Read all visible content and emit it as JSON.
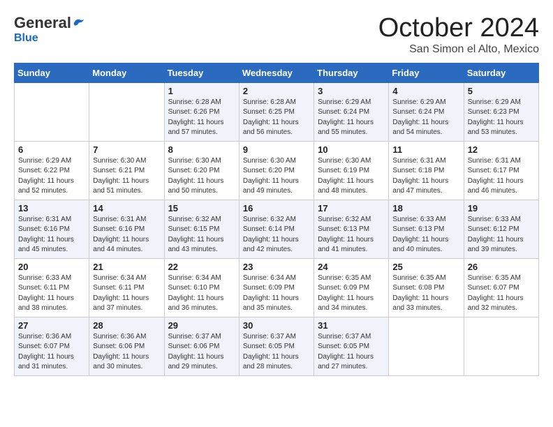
{
  "header": {
    "logo_general": "General",
    "logo_blue": "Blue",
    "month_title": "October 2024",
    "location": "San Simon el Alto, Mexico"
  },
  "weekdays": [
    "Sunday",
    "Monday",
    "Tuesday",
    "Wednesday",
    "Thursday",
    "Friday",
    "Saturday"
  ],
  "weeks": [
    [
      {
        "day": "",
        "sunrise": "",
        "sunset": "",
        "daylight": ""
      },
      {
        "day": "",
        "sunrise": "",
        "sunset": "",
        "daylight": ""
      },
      {
        "day": "1",
        "sunrise": "Sunrise: 6:28 AM",
        "sunset": "Sunset: 6:26 PM",
        "daylight": "Daylight: 11 hours and 57 minutes."
      },
      {
        "day": "2",
        "sunrise": "Sunrise: 6:28 AM",
        "sunset": "Sunset: 6:25 PM",
        "daylight": "Daylight: 11 hours and 56 minutes."
      },
      {
        "day": "3",
        "sunrise": "Sunrise: 6:29 AM",
        "sunset": "Sunset: 6:24 PM",
        "daylight": "Daylight: 11 hours and 55 minutes."
      },
      {
        "day": "4",
        "sunrise": "Sunrise: 6:29 AM",
        "sunset": "Sunset: 6:24 PM",
        "daylight": "Daylight: 11 hours and 54 minutes."
      },
      {
        "day": "5",
        "sunrise": "Sunrise: 6:29 AM",
        "sunset": "Sunset: 6:23 PM",
        "daylight": "Daylight: 11 hours and 53 minutes."
      }
    ],
    [
      {
        "day": "6",
        "sunrise": "Sunrise: 6:29 AM",
        "sunset": "Sunset: 6:22 PM",
        "daylight": "Daylight: 11 hours and 52 minutes."
      },
      {
        "day": "7",
        "sunrise": "Sunrise: 6:30 AM",
        "sunset": "Sunset: 6:21 PM",
        "daylight": "Daylight: 11 hours and 51 minutes."
      },
      {
        "day": "8",
        "sunrise": "Sunrise: 6:30 AM",
        "sunset": "Sunset: 6:20 PM",
        "daylight": "Daylight: 11 hours and 50 minutes."
      },
      {
        "day": "9",
        "sunrise": "Sunrise: 6:30 AM",
        "sunset": "Sunset: 6:20 PM",
        "daylight": "Daylight: 11 hours and 49 minutes."
      },
      {
        "day": "10",
        "sunrise": "Sunrise: 6:30 AM",
        "sunset": "Sunset: 6:19 PM",
        "daylight": "Daylight: 11 hours and 48 minutes."
      },
      {
        "day": "11",
        "sunrise": "Sunrise: 6:31 AM",
        "sunset": "Sunset: 6:18 PM",
        "daylight": "Daylight: 11 hours and 47 minutes."
      },
      {
        "day": "12",
        "sunrise": "Sunrise: 6:31 AM",
        "sunset": "Sunset: 6:17 PM",
        "daylight": "Daylight: 11 hours and 46 minutes."
      }
    ],
    [
      {
        "day": "13",
        "sunrise": "Sunrise: 6:31 AM",
        "sunset": "Sunset: 6:16 PM",
        "daylight": "Daylight: 11 hours and 45 minutes."
      },
      {
        "day": "14",
        "sunrise": "Sunrise: 6:31 AM",
        "sunset": "Sunset: 6:16 PM",
        "daylight": "Daylight: 11 hours and 44 minutes."
      },
      {
        "day": "15",
        "sunrise": "Sunrise: 6:32 AM",
        "sunset": "Sunset: 6:15 PM",
        "daylight": "Daylight: 11 hours and 43 minutes."
      },
      {
        "day": "16",
        "sunrise": "Sunrise: 6:32 AM",
        "sunset": "Sunset: 6:14 PM",
        "daylight": "Daylight: 11 hours and 42 minutes."
      },
      {
        "day": "17",
        "sunrise": "Sunrise: 6:32 AM",
        "sunset": "Sunset: 6:13 PM",
        "daylight": "Daylight: 11 hours and 41 minutes."
      },
      {
        "day": "18",
        "sunrise": "Sunrise: 6:33 AM",
        "sunset": "Sunset: 6:13 PM",
        "daylight": "Daylight: 11 hours and 40 minutes."
      },
      {
        "day": "19",
        "sunrise": "Sunrise: 6:33 AM",
        "sunset": "Sunset: 6:12 PM",
        "daylight": "Daylight: 11 hours and 39 minutes."
      }
    ],
    [
      {
        "day": "20",
        "sunrise": "Sunrise: 6:33 AM",
        "sunset": "Sunset: 6:11 PM",
        "daylight": "Daylight: 11 hours and 38 minutes."
      },
      {
        "day": "21",
        "sunrise": "Sunrise: 6:34 AM",
        "sunset": "Sunset: 6:11 PM",
        "daylight": "Daylight: 11 hours and 37 minutes."
      },
      {
        "day": "22",
        "sunrise": "Sunrise: 6:34 AM",
        "sunset": "Sunset: 6:10 PM",
        "daylight": "Daylight: 11 hours and 36 minutes."
      },
      {
        "day": "23",
        "sunrise": "Sunrise: 6:34 AM",
        "sunset": "Sunset: 6:09 PM",
        "daylight": "Daylight: 11 hours and 35 minutes."
      },
      {
        "day": "24",
        "sunrise": "Sunrise: 6:35 AM",
        "sunset": "Sunset: 6:09 PM",
        "daylight": "Daylight: 11 hours and 34 minutes."
      },
      {
        "day": "25",
        "sunrise": "Sunrise: 6:35 AM",
        "sunset": "Sunset: 6:08 PM",
        "daylight": "Daylight: 11 hours and 33 minutes."
      },
      {
        "day": "26",
        "sunrise": "Sunrise: 6:35 AM",
        "sunset": "Sunset: 6:07 PM",
        "daylight": "Daylight: 11 hours and 32 minutes."
      }
    ],
    [
      {
        "day": "27",
        "sunrise": "Sunrise: 6:36 AM",
        "sunset": "Sunset: 6:07 PM",
        "daylight": "Daylight: 11 hours and 31 minutes."
      },
      {
        "day": "28",
        "sunrise": "Sunrise: 6:36 AM",
        "sunset": "Sunset: 6:06 PM",
        "daylight": "Daylight: 11 hours and 30 minutes."
      },
      {
        "day": "29",
        "sunrise": "Sunrise: 6:37 AM",
        "sunset": "Sunset: 6:06 PM",
        "daylight": "Daylight: 11 hours and 29 minutes."
      },
      {
        "day": "30",
        "sunrise": "Sunrise: 6:37 AM",
        "sunset": "Sunset: 6:05 PM",
        "daylight": "Daylight: 11 hours and 28 minutes."
      },
      {
        "day": "31",
        "sunrise": "Sunrise: 6:37 AM",
        "sunset": "Sunset: 6:05 PM",
        "daylight": "Daylight: 11 hours and 27 minutes."
      },
      {
        "day": "",
        "sunrise": "",
        "sunset": "",
        "daylight": ""
      },
      {
        "day": "",
        "sunrise": "",
        "sunset": "",
        "daylight": ""
      }
    ]
  ]
}
